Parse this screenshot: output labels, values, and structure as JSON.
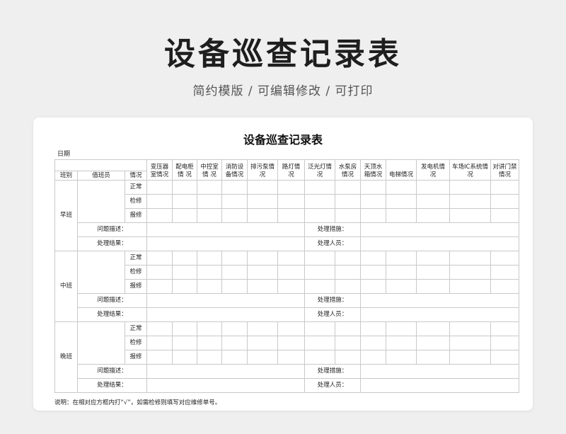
{
  "banner": {
    "title": "设备巡查记录表",
    "subtitle": "简约模版 /  可编辑修改  / 可打印"
  },
  "doc": {
    "title": "设备巡查记录表",
    "date_label": "日期",
    "header": {
      "shift": "班别",
      "staff": "值班员",
      "status": "情况",
      "equipment": [
        "变压器室情况",
        "配电柜情 况",
        "中控室情 况",
        "消防设备情况",
        "排污泵情 况",
        "路灯情况",
        "泛光灯情况",
        "水泵房情况",
        "天顶水箱情况",
        "电梯情况",
        "发电机情况",
        "车场IC系统情 况",
        "对讲门禁情况"
      ]
    },
    "shifts": [
      {
        "name": "早班",
        "rows": [
          "正常",
          "检修",
          "报修"
        ],
        "problem_label": "问题描述：",
        "measure_label": "处理措施：",
        "result_label": "处理结果：",
        "person_label": "处理人员："
      },
      {
        "name": "中班",
        "rows": [
          "正常",
          "检修",
          "报修"
        ],
        "problem_label": "问题描述：",
        "measure_label": "处理措施：",
        "result_label": "处理结果：",
        "person_label": "处理人员："
      },
      {
        "name": "晚班",
        "rows": [
          "正常",
          "检修",
          "报修"
        ],
        "problem_label": "问题描述：",
        "measure_label": "处理措施：",
        "result_label": "处理结果：",
        "person_label": "处理人员："
      }
    ],
    "note": "说明：在相对应方框内打“√”，如需检修则填写对应维修单号。"
  }
}
